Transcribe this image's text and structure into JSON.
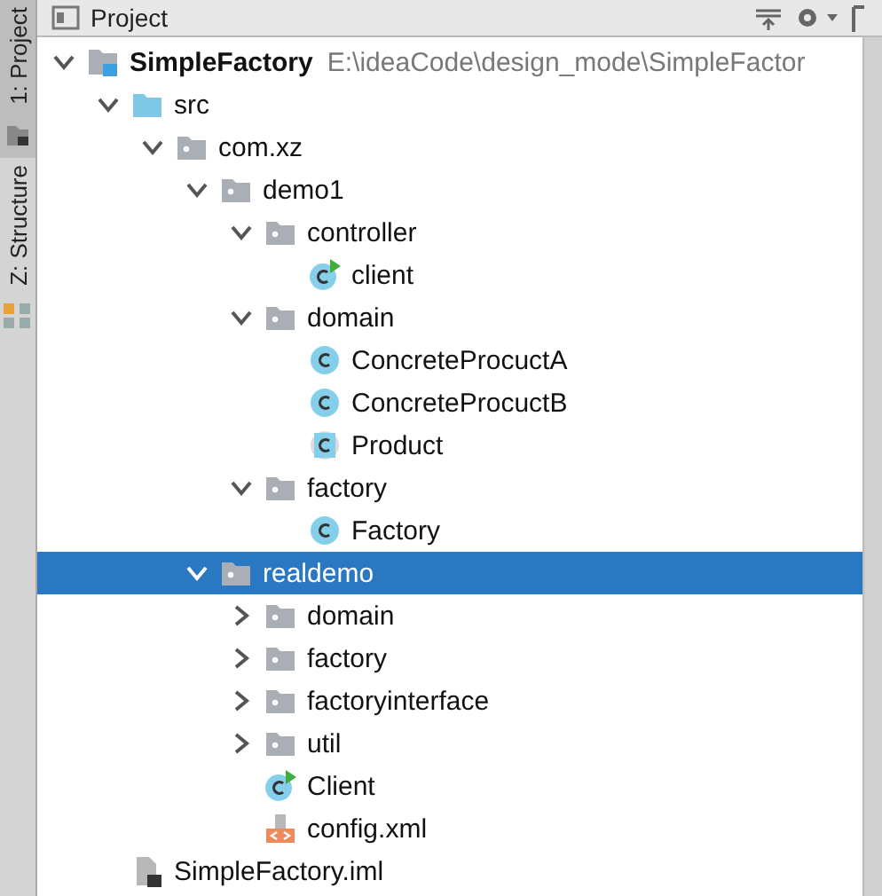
{
  "side_tabs": [
    {
      "label": "1: Project",
      "selected": true
    },
    {
      "label": "Z: Structure",
      "selected": false
    }
  ],
  "panel": {
    "title": "Project"
  },
  "tree": [
    {
      "label": "SimpleFactory",
      "kind": "module",
      "path": "E:\\ideaCode\\design_mode\\SimpleFactor",
      "expanded": true,
      "selected": false,
      "children": [
        {
          "label": "src",
          "kind": "source-folder",
          "expanded": true,
          "selected": false,
          "children": [
            {
              "label": "com.xz",
              "kind": "package",
              "expanded": true,
              "selected": false,
              "children": [
                {
                  "label": "demo1",
                  "kind": "package",
                  "expanded": true,
                  "selected": false,
                  "children": [
                    {
                      "label": "controller",
                      "kind": "package",
                      "expanded": true,
                      "selected": false,
                      "children": [
                        {
                          "label": "client",
                          "kind": "class-run",
                          "selected": false
                        }
                      ]
                    },
                    {
                      "label": "domain",
                      "kind": "package",
                      "expanded": true,
                      "selected": false,
                      "children": [
                        {
                          "label": "ConcreteProcuctA",
                          "kind": "class",
                          "selected": false
                        },
                        {
                          "label": "ConcreteProcuctB",
                          "kind": "class",
                          "selected": false
                        },
                        {
                          "label": "Product",
                          "kind": "abstract-class",
                          "selected": false
                        }
                      ]
                    },
                    {
                      "label": "factory",
                      "kind": "package",
                      "expanded": true,
                      "selected": false,
                      "children": [
                        {
                          "label": "Factory",
                          "kind": "class",
                          "selected": false
                        }
                      ]
                    }
                  ]
                },
                {
                  "label": "realdemo",
                  "kind": "package",
                  "expanded": true,
                  "selected": true,
                  "children": [
                    {
                      "label": "domain",
                      "kind": "package",
                      "expanded": false,
                      "selected": false
                    },
                    {
                      "label": "factory",
                      "kind": "package",
                      "expanded": false,
                      "selected": false
                    },
                    {
                      "label": "factoryinterface",
                      "kind": "package",
                      "expanded": false,
                      "selected": false
                    },
                    {
                      "label": "util",
                      "kind": "package",
                      "expanded": false,
                      "selected": false
                    },
                    {
                      "label": "Client",
                      "kind": "class-run",
                      "selected": false
                    },
                    {
                      "label": "config.xml",
                      "kind": "xml",
                      "selected": false
                    }
                  ]
                }
              ]
            }
          ]
        },
        {
          "label": "SimpleFactory.iml",
          "kind": "iml",
          "selected": false
        }
      ]
    }
  ]
}
